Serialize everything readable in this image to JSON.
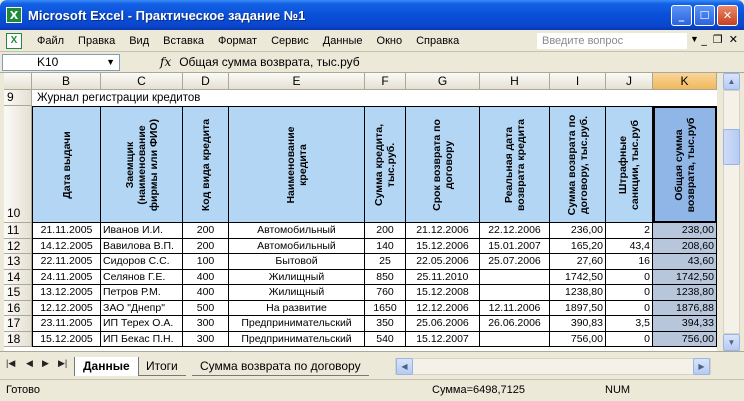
{
  "window": {
    "title": "Microsoft Excel - Практическое задание №1"
  },
  "menu": [
    "Файл",
    "Правка",
    "Вид",
    "Вставка",
    "Формат",
    "Сервис",
    "Данные",
    "Окно",
    "Справка"
  ],
  "help_placeholder": "Введите вопрос",
  "formula_bar": {
    "cell_ref": "K10",
    "fx": "fx",
    "formula": "Общая сумма возврата, тыс.руб"
  },
  "columns": [
    "B",
    "C",
    "D",
    "E",
    "F",
    "G",
    "H",
    "I",
    "J",
    "K"
  ],
  "row_numbers": [
    "9",
    "10",
    "11",
    "12",
    "13",
    "14",
    "15",
    "16",
    "17",
    "18"
  ],
  "journal_title": "Журнал регистрации кредитов",
  "headers": [
    "Дата выдачи",
    "Заемщик (наименование фирмы или ФИО)",
    "Код вида кредита",
    "Наименование кредита",
    "Сумма кредита, тыс.руб.",
    "Срок возврата по договору",
    "Реальная дата возврата кредита",
    "Сумма возврата по договору, тыс.руб.",
    "Штрафные санкции, тыс.руб",
    "Общая сумма возврата, тыс.руб"
  ],
  "rows": [
    [
      "21.11.2005",
      "Иванов И.И.",
      "200",
      "Автомобильный",
      "200",
      "21.12.2006",
      "22.12.2006",
      "236,00",
      "2",
      "238,00"
    ],
    [
      "14.12.2005",
      "Вавилова В.П.",
      "200",
      "Автомобильный",
      "140",
      "15.12.2006",
      "15.01.2007",
      "165,20",
      "43,4",
      "208,60"
    ],
    [
      "22.11.2005",
      "Сидоров С.С.",
      "100",
      "Бытовой",
      "25",
      "22.05.2006",
      "25.07.2006",
      "27,60",
      "16",
      "43,60"
    ],
    [
      "24.11.2005",
      "Селянов Г.Е.",
      "400",
      "Жилищный",
      "850",
      "25.11.2010",
      "",
      "1742,50",
      "0",
      "1742,50"
    ],
    [
      "13.12.2005",
      "Петров Р.М.",
      "400",
      "Жилищный",
      "760",
      "15.12.2008",
      "",
      "1238,80",
      "0",
      "1238,80"
    ],
    [
      "12.12.2005",
      "ЗАО \"Днепр\"",
      "500",
      "На развитие",
      "1650",
      "12.12.2006",
      "12.11.2006",
      "1897,50",
      "0",
      "1876,88"
    ],
    [
      "23.11.2005",
      "ИП Терех О.А.",
      "300",
      "Предпринимательский",
      "350",
      "25.06.2006",
      "26.06.2006",
      "390,83",
      "3,5",
      "394,33"
    ],
    [
      "15.12.2005",
      "ИП Бекас П.Н.",
      "300",
      "Предпринимательский",
      "540",
      "15.12.2007",
      "",
      "756,00",
      "0",
      "756,00"
    ]
  ],
  "sheet_tabs": [
    "Данные",
    "Итоги",
    "Сумма возврата по договору"
  ],
  "status": {
    "ready": "Готово",
    "sum": "Сумма=6498,7125",
    "num": "NUM"
  }
}
